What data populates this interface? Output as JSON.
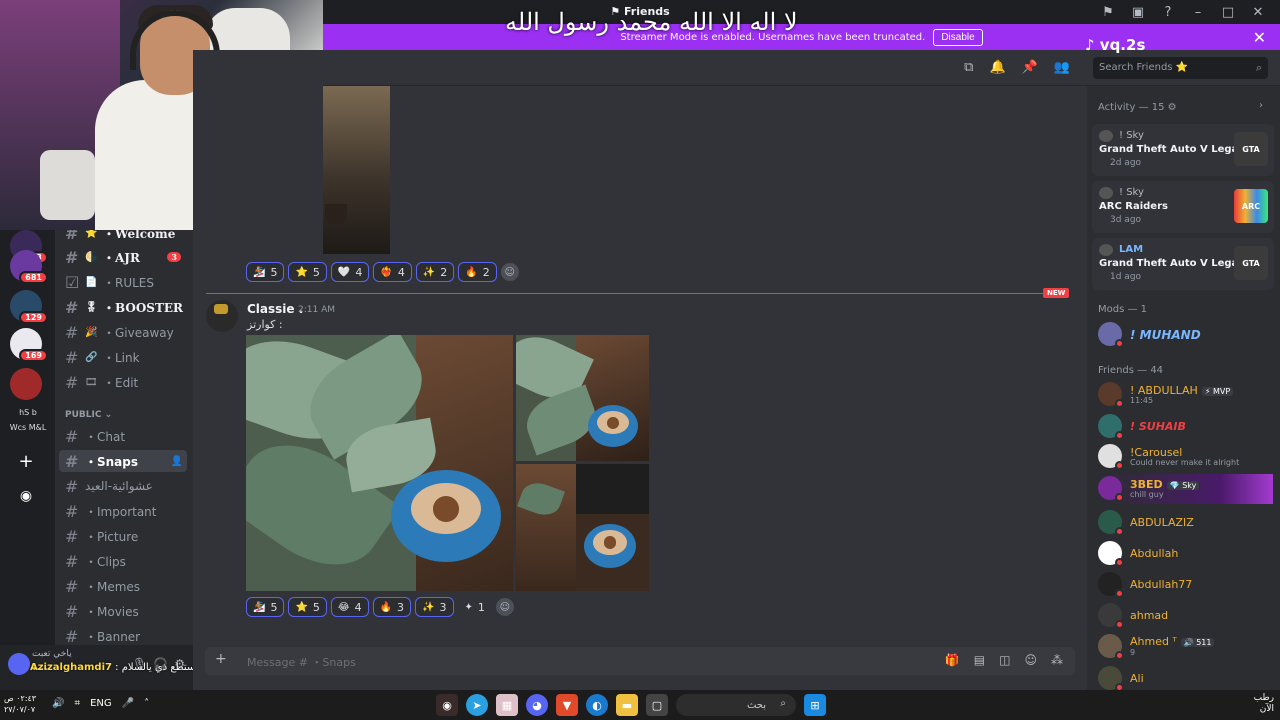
{
  "window": {
    "title": "Friends",
    "title_icon": "flag-icon"
  },
  "overlay": {
    "arabic_text": "لا اله الا الله محمد رسول الله",
    "tiktok_handle": "vq.2s",
    "chat_user": "Azizalghamdi7",
    "chat_message": ": يابه منجك تستطع ذي يالسلام"
  },
  "banner": {
    "text": "Streamer Mode is enabled. Usernames have been truncated.",
    "button": "Disable"
  },
  "server_rail": {
    "badges": [
      "3",
      "681",
      "129",
      "169"
    ],
    "label_a": "hS  b",
    "label_b": "Wcs M&L"
  },
  "channels": {
    "items": [
      {
        "name": "・Welcome",
        "emoji": "⭐",
        "style": "bold"
      },
      {
        "name": "・AJR",
        "emoji": "🌗",
        "style": "bold",
        "badge": "3"
      },
      {
        "name": "・RULES",
        "emoji": "📄",
        "style": "normal"
      },
      {
        "name": "・BOOSTER",
        "emoji": "🎖",
        "style": "bold"
      },
      {
        "name": "・Giveaway",
        "emoji": "🎉",
        "style": "normal"
      },
      {
        "name": "・Link",
        "emoji": "🔗",
        "style": "normal"
      },
      {
        "name": "・Edit",
        "emoji": "🎞",
        "style": "normal"
      }
    ],
    "category": "PUBLIC",
    "public": [
      {
        "name": "・Chat"
      },
      {
        "name": "・Snaps",
        "active": true
      },
      {
        "name": "عشوائية-العيد"
      },
      {
        "name": "・Important"
      },
      {
        "name": "・Picture"
      },
      {
        "name": "・Clips"
      },
      {
        "name": "・Memes"
      },
      {
        "name": "・Movies"
      },
      {
        "name": "・Banner"
      }
    ]
  },
  "user_panel": {
    "name": "!...",
    "status": "ياخي تعبت"
  },
  "search": {
    "placeholder": "Search Friends ⭐"
  },
  "message_top": {
    "reactions": [
      {
        "emoji": "🏂",
        "count": "5"
      },
      {
        "emoji": "⭐",
        "count": "5"
      },
      {
        "emoji": "🤍",
        "count": "4"
      },
      {
        "emoji": "❤‍🔥",
        "count": "4"
      },
      {
        "emoji": "✨",
        "count": "2"
      },
      {
        "emoji": "🔥",
        "count": "2"
      }
    ]
  },
  "new_label": "NEW",
  "message": {
    "author": "Classie .",
    "time": "2:11 AM",
    "text": "كوارتز :",
    "reactions": [
      {
        "emoji": "🏂",
        "count": "5"
      },
      {
        "emoji": "⭐",
        "count": "5"
      },
      {
        "emoji": "😂",
        "count": "4"
      },
      {
        "emoji": "🔥",
        "count": "3"
      },
      {
        "emoji": "✨",
        "count": "3"
      },
      {
        "emoji": "✦",
        "count": "1",
        "plain": true
      }
    ]
  },
  "composer": {
    "placeholder": "Message # ・Snaps"
  },
  "activity": {
    "header": "Activity — 15",
    "cards": [
      {
        "user": "! Sky",
        "game": "Grand Theft Auto V Legacy",
        "time": "2d ago",
        "art": "GTA",
        "art_color": "#3b3b3b"
      },
      {
        "user": "! Sky",
        "game": "ARC Raiders",
        "time": "3d ago",
        "art": "ARC",
        "art_color": "#1a1a1a"
      },
      {
        "user": "LAM",
        "game": "Grand Theft Auto V Legacy",
        "time": "1d ago",
        "art": "GTA",
        "art_color": "#3b3b3b"
      }
    ]
  },
  "mods": {
    "header": "Mods — 1",
    "members": [
      {
        "name": "! MUHAND",
        "color": "#7ab7ff"
      }
    ]
  },
  "friends": {
    "header": "Friends — 44",
    "members": [
      {
        "name": "! ABDULLAH",
        "tag": "⚡ MVP",
        "sub": "11:45",
        "color": "#f0b232",
        "avatar": "#5a3a2a"
      },
      {
        "name": "! SUHAIB",
        "sub": "",
        "color": "#f23f43",
        "avatar": "#2f6e6a"
      },
      {
        "name": "!Carousel",
        "sub": "Could never make it alright",
        "color": "#f0b232",
        "avatar": "#e0e0e0"
      },
      {
        "name": "3BED",
        "tag": "💎 Sky",
        "sub": "chill guy",
        "color": "#f0b232",
        "avatar": "#7a2a9a"
      },
      {
        "name": "ABDULAZIZ",
        "sub": "",
        "color": "#f0b232",
        "avatar": "#2a5a4a"
      },
      {
        "name": "Abdullah",
        "sub": "",
        "color": "#f0b232",
        "avatar": "#ffffff"
      },
      {
        "name": "Abdullah77",
        "sub": "",
        "color": "#f0b232",
        "avatar": "#222222"
      },
      {
        "name": "ahmad",
        "sub": "",
        "color": "#f0b232",
        "avatar": "#3a3a3a"
      },
      {
        "name": "Ahmed ᵀ",
        "tag": "🔊 511",
        "sub": "9",
        "color": "#f0b232",
        "avatar": "#6a5a4a"
      },
      {
        "name": "Ali",
        "sub": "",
        "color": "#f0b232",
        "avatar": "#4a4a3a"
      }
    ]
  },
  "taskbar": {
    "clock_time": "٠٢:٤٣ ص",
    "clock_date": "٢٧/٠٧/٠٧",
    "lang": "ENG",
    "search_placeholder": "بحث",
    "weather": "رطب",
    "weather_sub": "الآن"
  }
}
